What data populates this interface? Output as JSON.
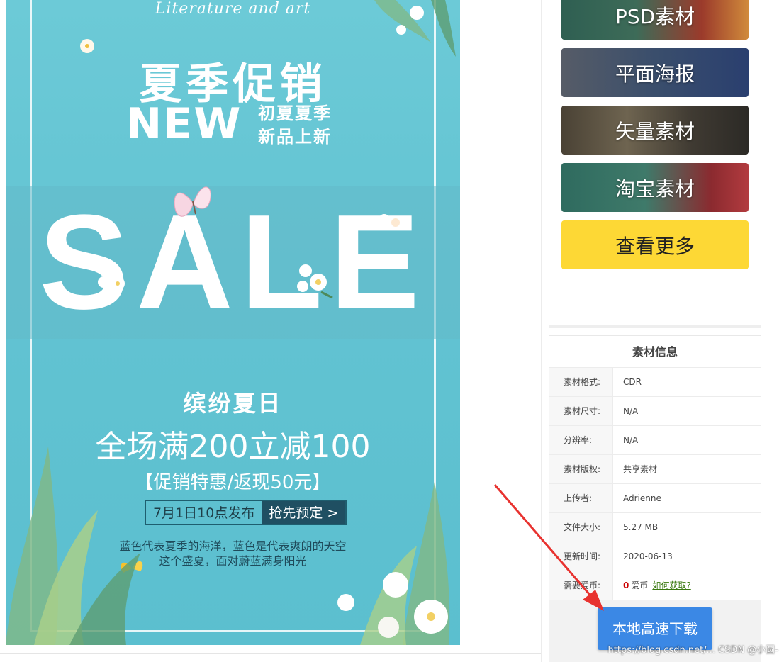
{
  "poster": {
    "subtitle": "Literature and art",
    "title": "夏季促销",
    "new_label": "NEW",
    "new_sub_line1": "初夏夏季",
    "new_sub_line2": "新品上新",
    "sale": "SALE",
    "theme": "缤纷夏日",
    "promo": "全场满200立减100",
    "cashback": "【促销特惠/返现50元】",
    "cta_date": "7月1日10点发布",
    "cta_button": "抢先预定 >",
    "desc_line1": "蓝色代表夏季的海洋，蓝色是代表爽朗的天空",
    "desc_line2": "这个盛夏，面对蔚蓝满身阳光"
  },
  "categories": [
    {
      "label": "PSD素材"
    },
    {
      "label": "平面海报"
    },
    {
      "label": "矢量素材"
    },
    {
      "label": "淘宝素材"
    },
    {
      "label": "查看更多"
    }
  ],
  "info": {
    "title": "素材信息",
    "rows": [
      {
        "key": "素材格式:",
        "value": "CDR"
      },
      {
        "key": "素材尺寸:",
        "value": "N/A"
      },
      {
        "key": "分辨率:",
        "value": "N/A"
      },
      {
        "key": "素材版权:",
        "value": "共享素材"
      },
      {
        "key": "上传者:",
        "value": "Adrienne"
      },
      {
        "key": "文件大小:",
        "value": "5.27 MB"
      },
      {
        "key": "更新时间:",
        "value": "2020-06-13"
      }
    ],
    "coin_key": "需要爱币:",
    "coin_amount": "0",
    "coin_unit": "爱币",
    "coin_link": "如何获取?",
    "download_button": "本地高速下载"
  },
  "watermark": "https://blog.csdn.net/... CSDN @小圆-",
  "colors": {
    "poster_bg": "#62c3d2",
    "more_button": "#fdd835",
    "download_button": "#3b88e5",
    "arrow": "#e8322f"
  }
}
